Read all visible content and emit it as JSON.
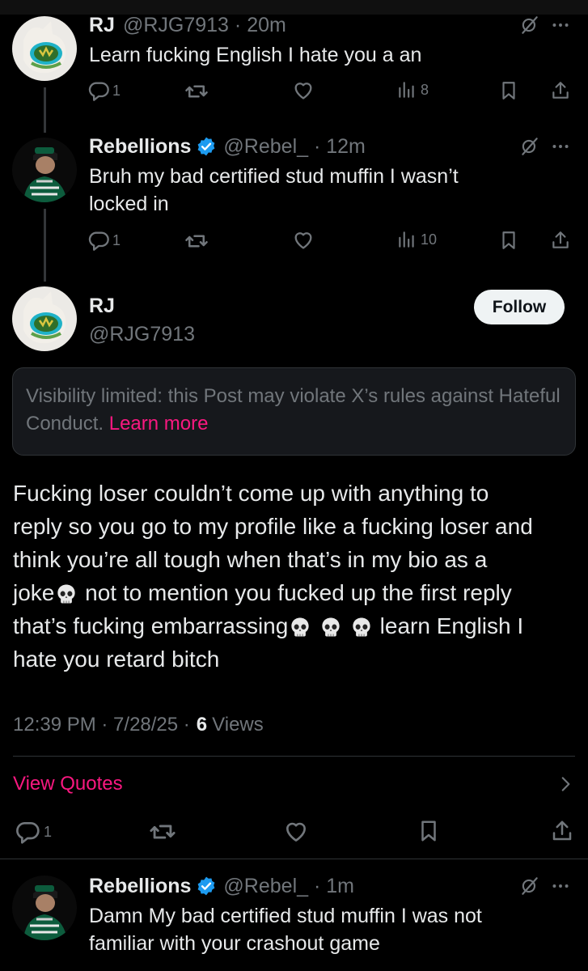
{
  "posts": [
    {
      "name": "RJ",
      "handle": "@RJG7913",
      "time": "20m",
      "text": "Learn fucking English I hate you a an",
      "replies": "1",
      "views": "8"
    },
    {
      "name": "Rebellions",
      "handle": "@Rebel_",
      "time": "12m",
      "text_line1": "Bruh my bad certified stud muffin I wasn’t",
      "text_line2": "locked in",
      "replies": "1",
      "views": "10"
    }
  ],
  "main": {
    "name": "RJ",
    "handle": "@RJG7913",
    "follow_label": "Follow",
    "notice_text": "Visibility limited: this Post may violate X’s rules against Hateful Conduct.",
    "notice_link": "Learn more",
    "body": {
      "l1": "Fucking loser couldn’t come up with anything to",
      "l2": "reply so you go to my profile like a fucking loser and",
      "l3": "think you’re all tough when that’s in my bio as a",
      "l4a": "joke",
      "l4b": " not to mention you fucked up the first reply",
      "l5a": "that’s fucking embarrassing",
      "l5b": " learn English I",
      "l6": "hate you retard bitch"
    },
    "timestamp": "12:39 PM · 7/28/25 ·",
    "view_count": "6",
    "views_label": "Views",
    "view_quotes": "View Quotes",
    "replies": "1"
  },
  "reply": {
    "name": "Rebellions",
    "handle": "@Rebel_",
    "time": "1m",
    "text_line1": "Damn My bad certified stud muffin I was not",
    "text_line2": "familiar with your crashout game"
  },
  "colors": {
    "background": "#000000",
    "text": "#e7e9ea",
    "muted": "#71767b",
    "link": "#f91880",
    "verified": "#1d9bf0"
  },
  "icons": [
    "reply-icon",
    "repost-icon",
    "like-icon",
    "views-icon",
    "bookmark-icon",
    "share-icon",
    "grok-icon",
    "more-icon",
    "verified-icon",
    "skull-emoji",
    "chevron-right-icon"
  ]
}
